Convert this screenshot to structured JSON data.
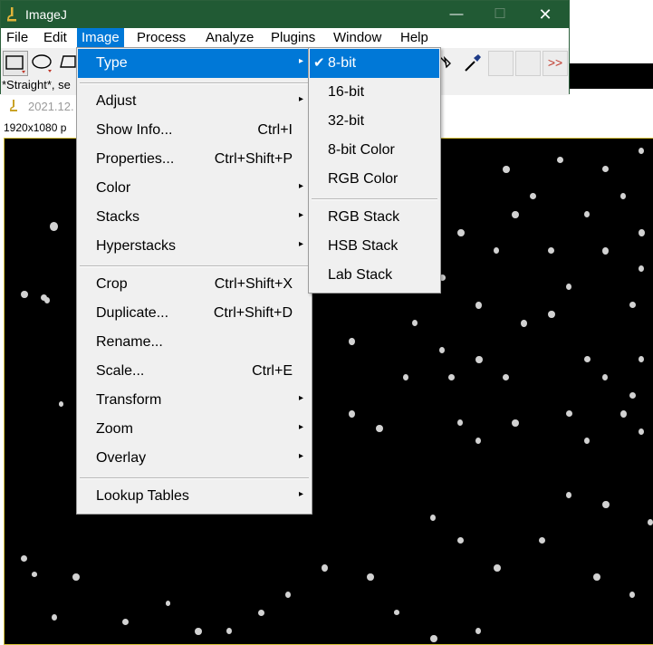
{
  "app": {
    "title": "ImageJ"
  },
  "window_buttons": {
    "minimize": "—",
    "maximize": "☐",
    "close": "✕"
  },
  "menubar": [
    "File",
    "Edit",
    "Image",
    "Process",
    "Analyze",
    "Plugins",
    "Window",
    "Help"
  ],
  "active_menu": "Image",
  "toolbar": {
    "overflow": ">>",
    "icons": [
      "rectangle-tool-icon",
      "oval-tool-icon",
      "polygon-tool-icon",
      "wand-tool-icon",
      "color-picker-icon"
    ]
  },
  "status": "*Straight*, se",
  "image_window": {
    "title": "2021.12.",
    "info": "1920x1080 p"
  },
  "image_menu": {
    "items": [
      {
        "label": "Type",
        "shortcut": "",
        "submenu": true
      },
      {
        "label": "Adjust",
        "shortcut": "",
        "submenu": true
      },
      {
        "label": "Show Info...",
        "shortcut": "Ctrl+I",
        "submenu": false
      },
      {
        "label": "Properties...",
        "shortcut": "Ctrl+Shift+P",
        "submenu": false
      },
      {
        "label": "Color",
        "shortcut": "",
        "submenu": true
      },
      {
        "label": "Stacks",
        "shortcut": "",
        "submenu": true
      },
      {
        "label": "Hyperstacks",
        "shortcut": "",
        "submenu": true
      },
      {
        "label": "Crop",
        "shortcut": "Ctrl+Shift+X",
        "submenu": false
      },
      {
        "label": "Duplicate...",
        "shortcut": "Ctrl+Shift+D",
        "submenu": false
      },
      {
        "label": "Rename...",
        "shortcut": "",
        "submenu": false
      },
      {
        "label": "Scale...",
        "shortcut": "Ctrl+E",
        "submenu": false
      },
      {
        "label": "Transform",
        "shortcut": "",
        "submenu": true
      },
      {
        "label": "Zoom",
        "shortcut": "",
        "submenu": true
      },
      {
        "label": "Overlay",
        "shortcut": "",
        "submenu": true
      },
      {
        "label": "Lookup Tables",
        "shortcut": "",
        "submenu": true
      }
    ]
  },
  "type_menu": {
    "checkmark": "✔",
    "items": [
      "8-bit",
      "16-bit",
      "32-bit",
      "8-bit Color",
      "RGB Color",
      "RGB Stack",
      "HSB Stack",
      "Lab Stack"
    ],
    "checked": "8-bit"
  },
  "submenu_arrow": "▸",
  "colors": {
    "titlebar": "#215a34",
    "highlight": "#0078d7",
    "menu_bg": "#f0f0f0",
    "overflow_arrows": "#c0392b"
  }
}
